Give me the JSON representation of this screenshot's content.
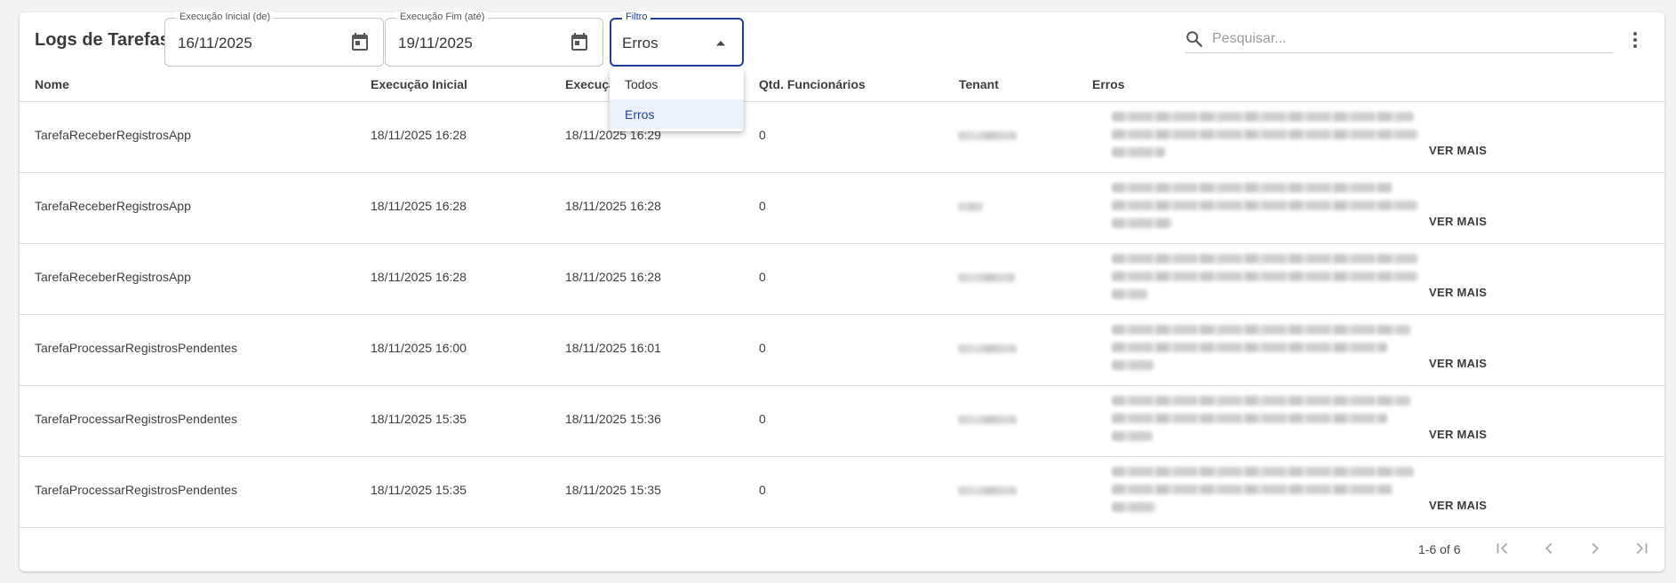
{
  "page": {
    "title": "Logs de Tarefas"
  },
  "filters": {
    "start": {
      "label": "Execução Inicial (de)",
      "value": "16/11/2025",
      "icon": "calendar-icon"
    },
    "end": {
      "label": "Execução Fim (até)",
      "value": "19/11/2025",
      "icon": "calendar-icon"
    },
    "filter": {
      "label": "Filtro",
      "value": "Erros",
      "icon": "caret-up-icon",
      "options": [
        "Todos",
        "Erros"
      ],
      "selected": "Erros"
    }
  },
  "search": {
    "placeholder": "Pesquisar...",
    "icon": "search-icon"
  },
  "menu_icon": "more-vert-icon",
  "table": {
    "columns": [
      "Nome",
      "Execução Inicial",
      "Execução Fim",
      "Qtd. Funcionários",
      "Tenant",
      "Erros"
    ],
    "rows": [
      {
        "nome": "TarefaReceberRegistrosApp",
        "inicio": "18/11/2025 16:28",
        "fim": "18/11/2025 16:29",
        "qtd": "0",
        "action": "VER MAIS"
      },
      {
        "nome": "TarefaReceberRegistrosApp",
        "inicio": "18/11/2025 16:28",
        "fim": "18/11/2025 16:28",
        "qtd": "0",
        "action": "VER MAIS"
      },
      {
        "nome": "TarefaReceberRegistrosApp",
        "inicio": "18/11/2025 16:28",
        "fim": "18/11/2025 16:28",
        "qtd": "0",
        "action": "VER MAIS"
      },
      {
        "nome": "TarefaProcessarRegistrosPendentes",
        "inicio": "18/11/2025 16:00",
        "fim": "18/11/2025 16:01",
        "qtd": "0",
        "action": "VER MAIS"
      },
      {
        "nome": "TarefaProcessarRegistrosPendentes",
        "inicio": "18/11/2025 15:35",
        "fim": "18/11/2025 15:36",
        "qtd": "0",
        "action": "VER MAIS"
      },
      {
        "nome": "TarefaProcessarRegistrosPendentes",
        "inicio": "18/11/2025 15:35",
        "fim": "18/11/2025 15:35",
        "qtd": "0",
        "action": "VER MAIS"
      }
    ]
  },
  "pagination": {
    "range": "1-6 of 6",
    "icons": [
      "first-page-icon",
      "chevron-left-icon",
      "chevron-right-icon",
      "last-page-icon"
    ]
  },
  "colors": {
    "accent": "#1f3f97",
    "selected_bg": "#ecf0f8"
  }
}
